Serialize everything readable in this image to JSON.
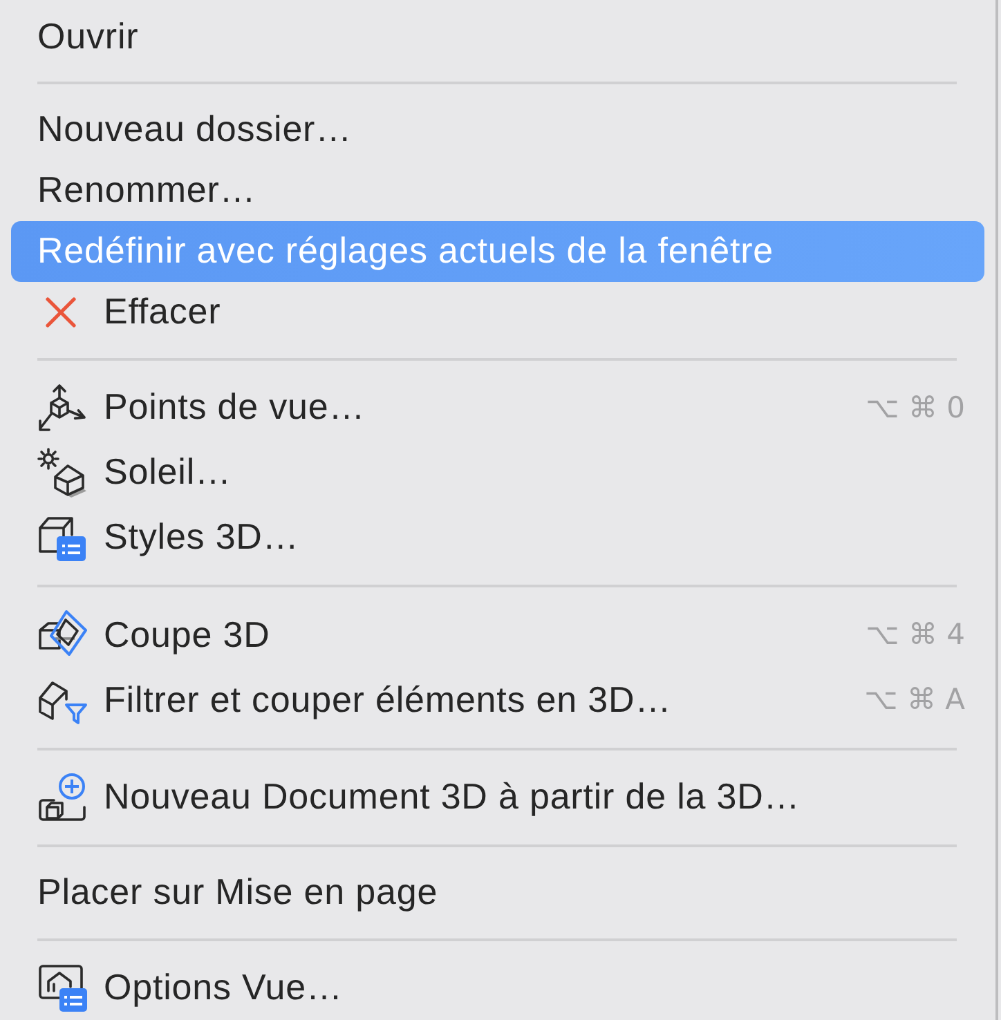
{
  "menu": {
    "items": [
      {
        "kind": "text",
        "label": "Ouvrir",
        "selected": false
      },
      {
        "kind": "separator"
      },
      {
        "kind": "text",
        "label": "Nouveau dossier…",
        "selected": false
      },
      {
        "kind": "text",
        "label": "Renommer…",
        "selected": false
      },
      {
        "kind": "text",
        "label": "Redéfinir avec réglages actuels de la fenêtre",
        "selected": true
      },
      {
        "kind": "icon",
        "label": "Effacer",
        "selected": false
      },
      {
        "kind": "separator"
      },
      {
        "kind": "icon",
        "label": "Points de vue…",
        "shortcut": "⌥ ⌘ 0",
        "selected": false
      },
      {
        "kind": "icon",
        "label": "Soleil…",
        "selected": false
      },
      {
        "kind": "icon",
        "label": "Styles 3D…",
        "selected": false
      },
      {
        "kind": "separator"
      },
      {
        "kind": "icon",
        "label": "Coupe 3D",
        "shortcut": "⌥ ⌘ 4",
        "selected": false
      },
      {
        "kind": "icon",
        "label": "Filtrer et couper éléments en 3D…",
        "shortcut": "⌥ ⌘ A",
        "selected": false
      },
      {
        "kind": "separator"
      },
      {
        "kind": "icon",
        "label": "Nouveau Document 3D à partir de la 3D…",
        "selected": false
      },
      {
        "kind": "separator"
      },
      {
        "kind": "text",
        "label": "Placer sur Mise en page",
        "selected": false
      },
      {
        "kind": "separator"
      },
      {
        "kind": "icon",
        "label": "Options Vue…",
        "selected": false
      }
    ]
  }
}
